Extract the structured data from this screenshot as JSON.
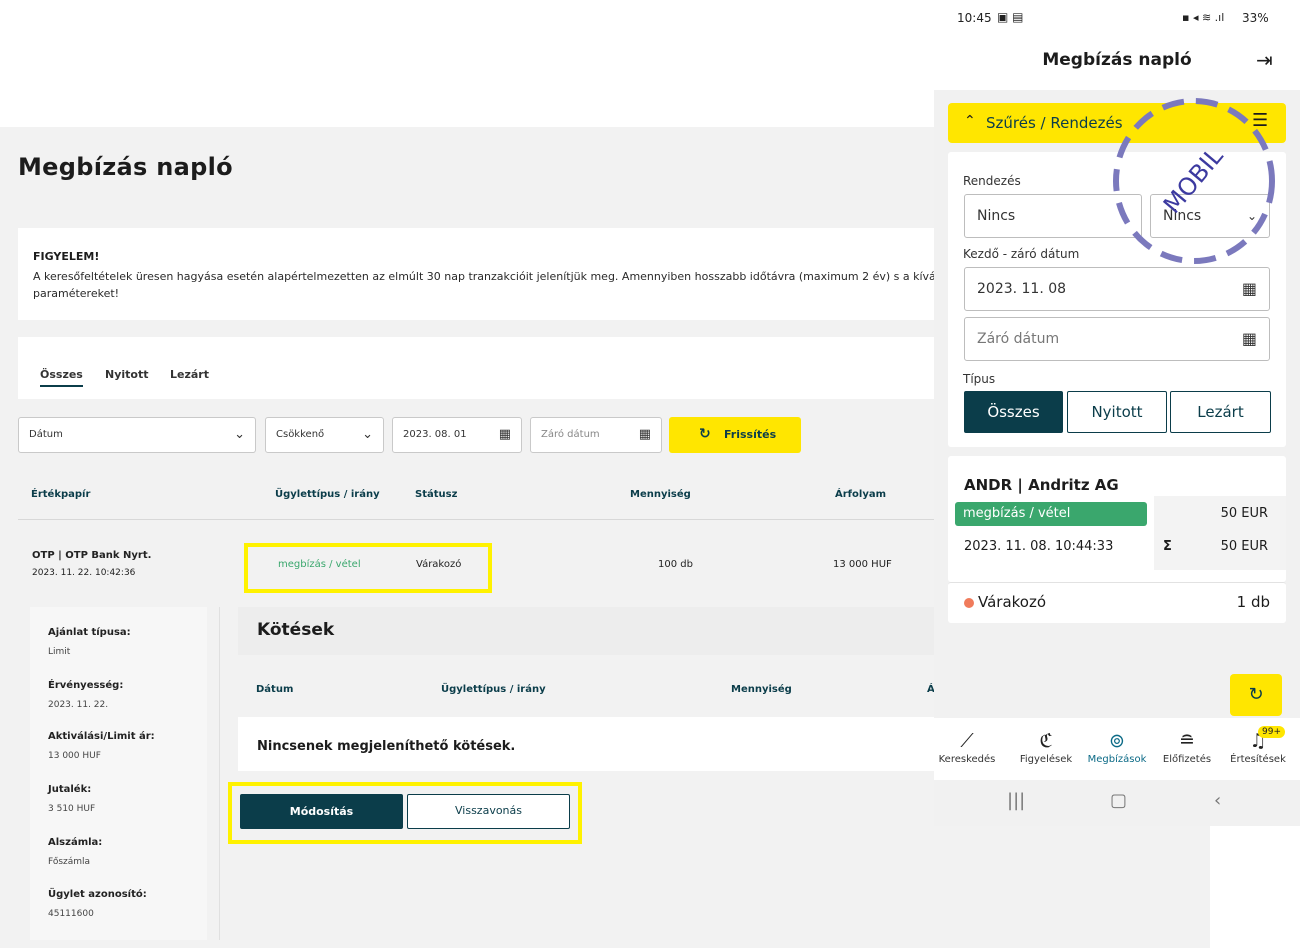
{
  "desktop": {
    "title": "Megbízás napló",
    "notice": {
      "title": "FIGYELEM!",
      "text": "A keresőfeltételek üresen hagyása esetén alapértelmezetten az elmúlt 30 nap tranzakcióit jelenítjük meg. Amennyiben hosszabb időtávra (maximum 2 év) s a kívánt paramétereket!"
    },
    "tabs": [
      "Összes",
      "Nyitott",
      "Lezárt"
    ],
    "filters": {
      "sort_field": "Dátum",
      "sort_order": "Csökkenő",
      "start_date": "2023. 08. 01",
      "end_date_placeholder": "Záró dátum",
      "refresh_label": "Frissítés"
    },
    "table_headers": [
      "Értékpapír",
      "Ügylettípus / irány",
      "Státusz",
      "Mennyiség",
      "Árfolyam"
    ],
    "row": {
      "security": "OTP | OTP Bank Nyrt.",
      "timestamp": "2023. 11. 22. 10:42:36",
      "type": "megbízás / vétel",
      "status": "Várakozó",
      "quantity": "100 db",
      "price": "13 000 HUF"
    },
    "details": [
      {
        "label": "Ajánlat típusa:",
        "value": "Limit"
      },
      {
        "label": "Érvényesség:",
        "value": "2023. 11. 22."
      },
      {
        "label": "Aktiválási/Limit ár:",
        "value": "13 000 HUF"
      },
      {
        "label": "Jutalék:",
        "value": "3 510 HUF"
      },
      {
        "label": "Alszámla:",
        "value": "Főszámla"
      },
      {
        "label": "Ügylet azonosító:",
        "value": "45111600"
      }
    ],
    "trades": {
      "title": "Kötések",
      "headers": [
        "Dátum",
        "Ügylettípus / irány",
        "Mennyiség",
        "Á"
      ],
      "empty": "Nincsenek megjeleníthető kötések."
    },
    "buttons": {
      "modify": "Módosítás",
      "cancel": "Visszavonás"
    }
  },
  "mobile": {
    "status_time": "10:45",
    "status_right": "33%",
    "title": "Megbízás napló",
    "filter_label": "Szűrés / Rendezés",
    "sort_label": "Rendezés",
    "sort_value_1": "Nincs",
    "sort_value_2": "Nincs",
    "date_label": "Kezdő - záró dátum",
    "start_date": "2023. 11. 08",
    "end_date_placeholder": "Záró dátum",
    "type_label": "Típus",
    "segments": [
      "Összes",
      "Nyitott",
      "Lezárt"
    ],
    "order": {
      "name": "ANDR | Andritz AG",
      "type": "megbízás / vétel",
      "amount": "50 EUR",
      "timestamp": "2023. 11. 08. 10:44:33",
      "sigma": "Σ",
      "total": "50 EUR",
      "status": "Várakozó",
      "quantity": "1 db"
    },
    "nav": [
      "Kereskedés",
      "Figyelések",
      "Megbízások",
      "Előfizetés",
      "Értesítések"
    ],
    "badge": "99+",
    "stamp": "MOBIL"
  },
  "colors": {
    "accent_yellow": "#ffe600",
    "dark_teal": "#0b3d4a",
    "green": "#3aa76d",
    "stamp": "#7b79bd"
  },
  "icons": [
    "chevron-down-icon",
    "calendar-icon",
    "refresh-icon",
    "logout-icon",
    "sliders-icon",
    "chart-icon",
    "watch-icon",
    "orders-icon",
    "coins-icon",
    "bell-icon"
  ]
}
